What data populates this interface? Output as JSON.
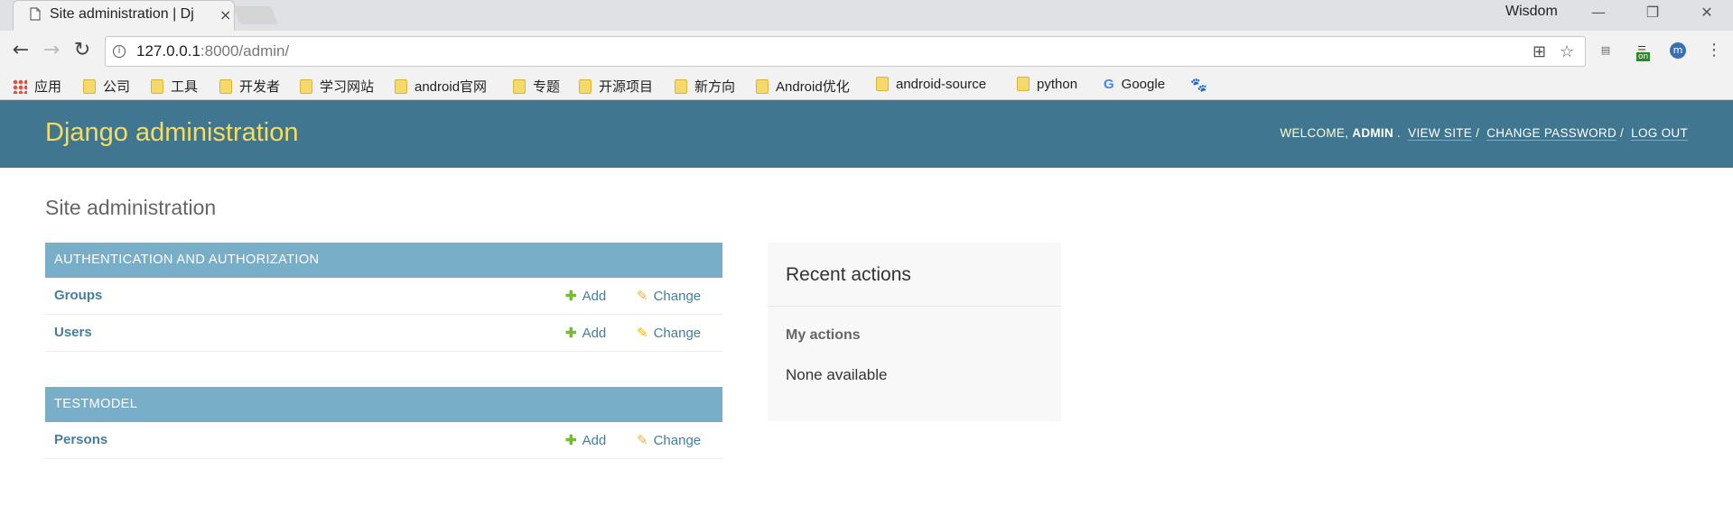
{
  "browser": {
    "tab_title": "Site administration | Dj",
    "tab_close": "×",
    "profile_name": "Wisdom",
    "url_host": "127.0.0.1",
    "url_rest": ":8000/admin/",
    "bookmarks": [
      {
        "label": "应用",
        "icon": "apps-icon"
      },
      {
        "label": "公司",
        "icon": "folder-icon"
      },
      {
        "label": "工具",
        "icon": "folder-icon"
      },
      {
        "label": "开发者",
        "icon": "folder-icon"
      },
      {
        "label": "学习网站",
        "icon": "folder-icon"
      },
      {
        "label": "android官网",
        "icon": "folder-icon"
      },
      {
        "label": "专题",
        "icon": "folder-icon"
      },
      {
        "label": "开源项目",
        "icon": "folder-icon"
      },
      {
        "label": "新方向",
        "icon": "folder-icon"
      },
      {
        "label": "Android优化",
        "icon": "folder-icon"
      },
      {
        "label": "android-source",
        "icon": "folder-icon"
      },
      {
        "label": "python",
        "icon": "folder-icon"
      },
      {
        "label": "Google",
        "icon": "google-icon"
      }
    ],
    "ext_badge": "on"
  },
  "admin": {
    "branding": "Django administration",
    "welcome": "WELCOME,",
    "username": "ADMIN",
    "view_site": "VIEW SITE",
    "change_password": "CHANGE PASSWORD",
    "log_out": "LOG OUT",
    "page_title": "Site administration",
    "modules": [
      {
        "caption": "AUTHENTICATION AND AUTHORIZATION",
        "models": [
          {
            "name": "Groups",
            "add": "Add",
            "change": "Change"
          },
          {
            "name": "Users",
            "add": "Add",
            "change": "Change"
          }
        ]
      },
      {
        "caption": "TESTMODEL",
        "models": [
          {
            "name": "Persons",
            "add": "Add",
            "change": "Change"
          }
        ]
      }
    ],
    "recent": {
      "title": "Recent actions",
      "subtitle": "My actions",
      "empty": "None available"
    }
  },
  "colors": {
    "header_bg": "#417690",
    "branding": "#f5dd5d",
    "caption_bg": "#79aec8",
    "link": "#447e9b",
    "add": "#70bf2b",
    "change": "#efb80b"
  }
}
